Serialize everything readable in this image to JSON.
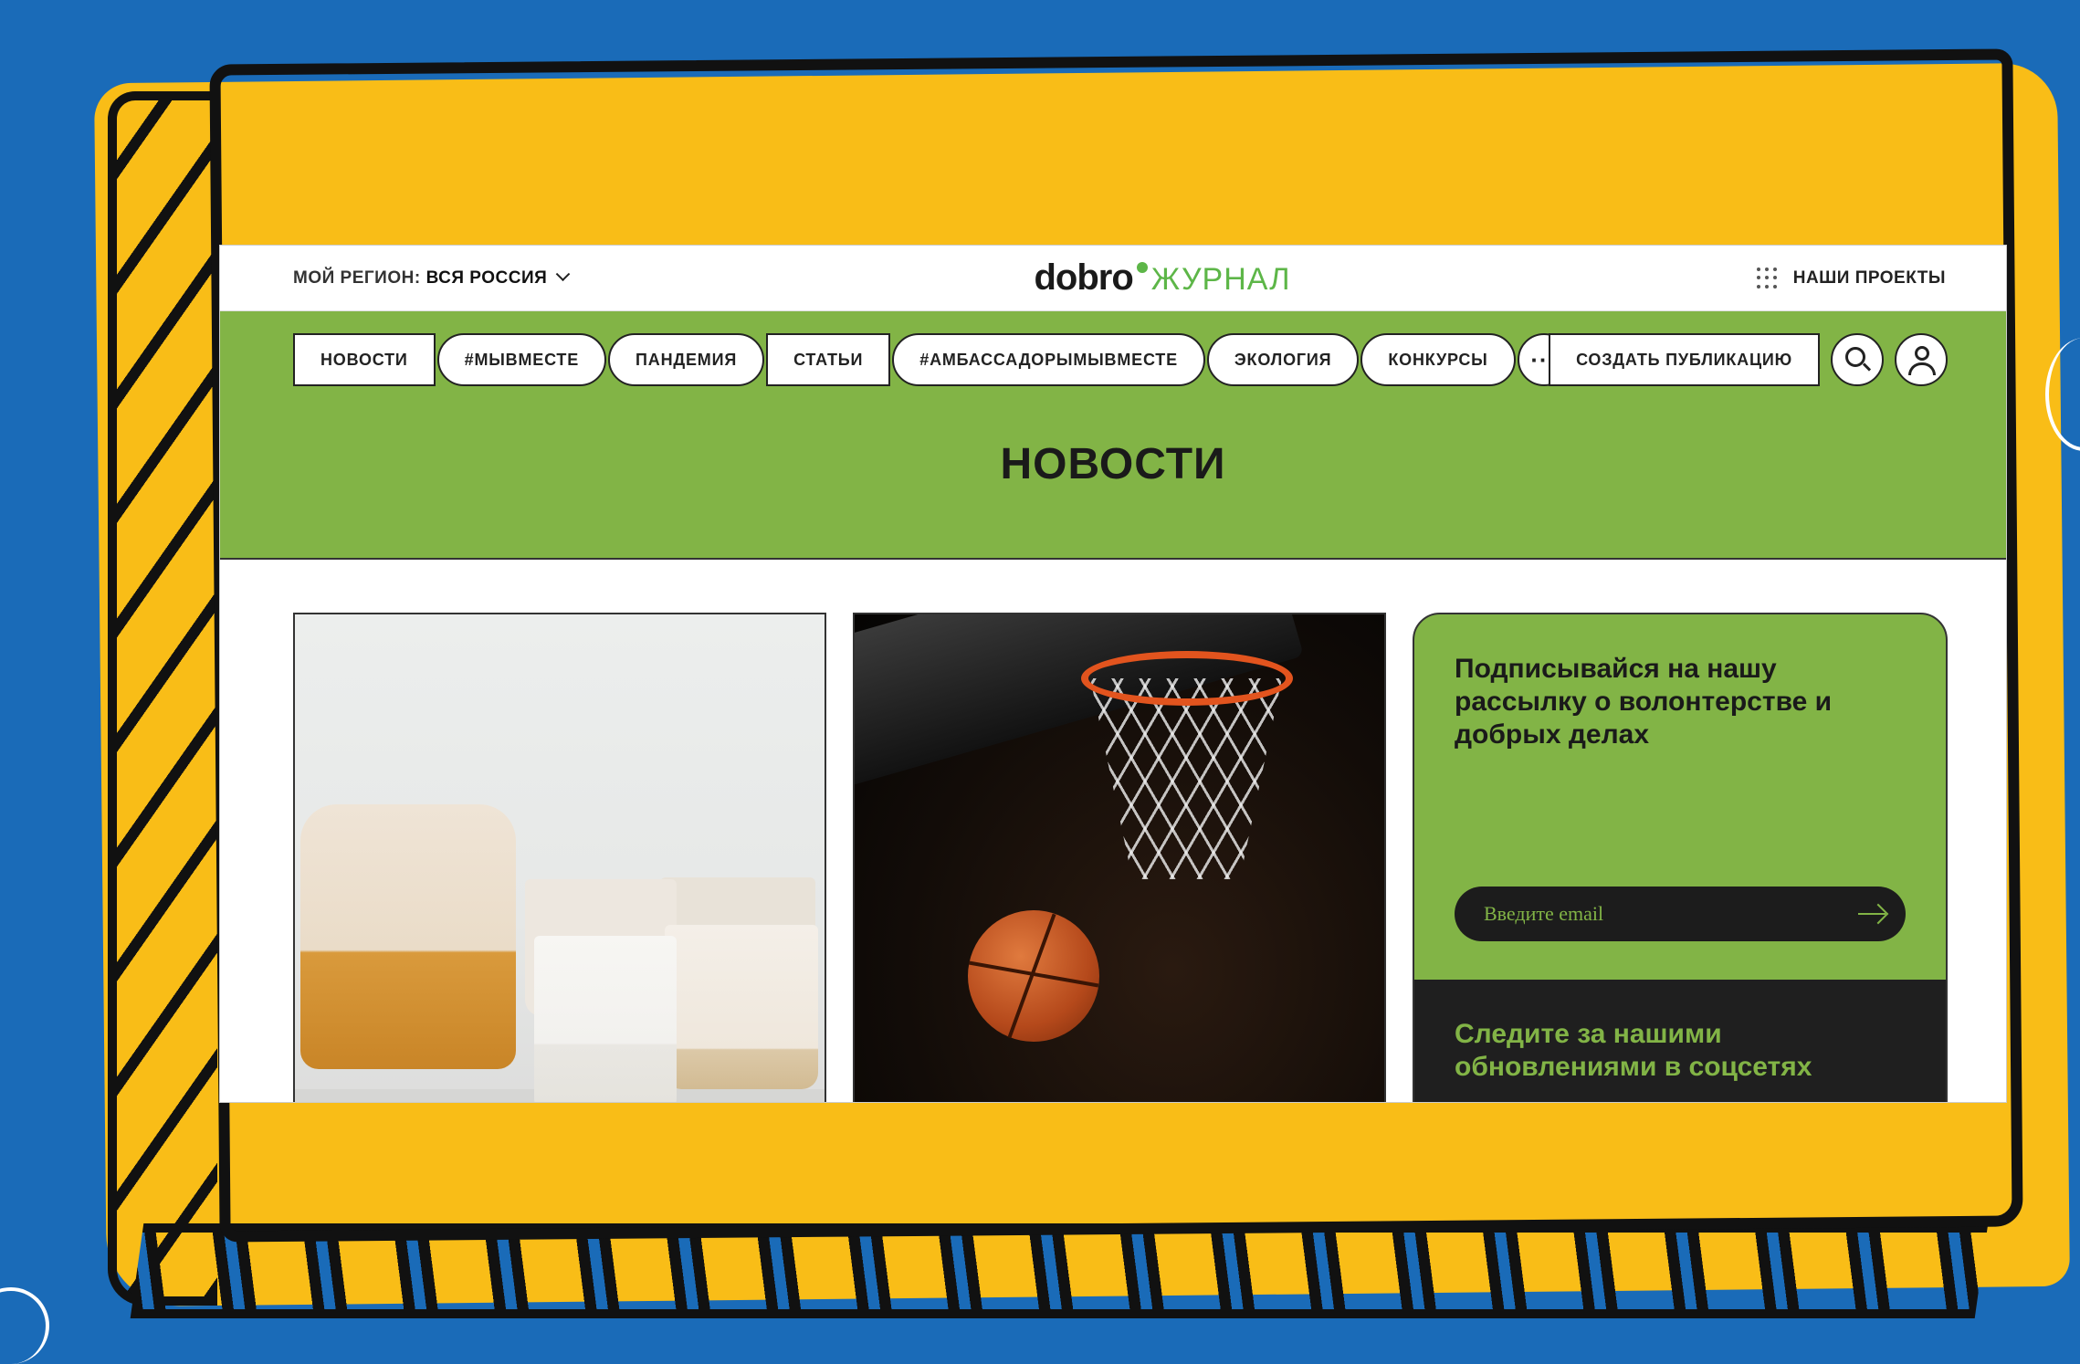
{
  "header": {
    "region_label": "МОЙ РЕГИОН:",
    "region_value": "ВСЯ РОССИЯ",
    "logo_brand": "dobro",
    "logo_journal": "ЖУРНАЛ",
    "projects_label": "НАШИ ПРОЕКТЫ"
  },
  "nav": {
    "items": [
      {
        "label": "НОВОСТИ"
      },
      {
        "label": "#МЫВМЕСТЕ"
      },
      {
        "label": "ПАНДЕМИЯ"
      },
      {
        "label": "СТАТЬИ"
      },
      {
        "label": "#АМБАССАДОРЫМЫВМЕСТЕ"
      },
      {
        "label": "ЭКОЛОГИЯ"
      },
      {
        "label": "КОНКУРСЫ"
      }
    ],
    "more_label": "···",
    "create_label": "СОЗДАТЬ ПУБЛИКАЦИЮ"
  },
  "page": {
    "title": "НОВОСТИ"
  },
  "subscribe": {
    "title": "Подписывайся на нашу рассылку о волонтерстве и добрых делах",
    "email_placeholder": "Введите email",
    "social_title": "Следите за нашими обновлениями в соцсетях"
  },
  "colors": {
    "accent_green": "#82b446",
    "logo_green": "#5db648",
    "background_blue": "#1a6bb8",
    "frame_yellow": "#f9bd17"
  },
  "icons": {
    "region": "chevron-down-icon",
    "projects": "grid-dots-icon",
    "search": "search-icon",
    "profile": "user-icon",
    "submit": "arrow-right-icon"
  }
}
